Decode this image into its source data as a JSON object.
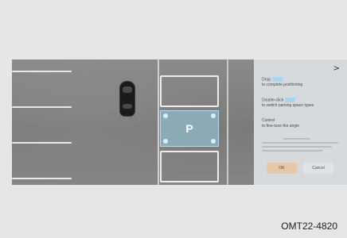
{
  "panel": {
    "close_icon": ">",
    "hints": [
      {
        "title": "Drag",
        "desc": "to complete positioning"
      },
      {
        "title": "Double-click",
        "desc": "to switch parking space types"
      },
      {
        "title": "Control",
        "desc": "to fine-tune the angle"
      }
    ],
    "ok_label": "OK",
    "cancel_label": "Cancel"
  },
  "parking": {
    "slot_label": "P",
    "target_color": "#a6d6ee"
  },
  "caption": "OMT22-4820"
}
